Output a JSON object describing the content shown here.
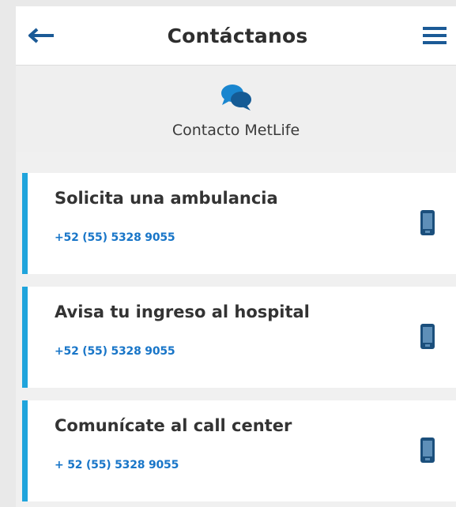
{
  "header": {
    "title": "Contáctanos",
    "back_icon": "arrow-left-icon",
    "menu_icon": "hamburger-menu-icon"
  },
  "subheader": {
    "icon": "chat-bubbles-icon",
    "label": "Contacto MetLife"
  },
  "contacts": [
    {
      "title": "Solicita una ambulancia",
      "phone": "+52 (55) 5328 9055",
      "icon": "mobile-phone-icon"
    },
    {
      "title": "Avisa tu ingreso al hospital",
      "phone": "+52 (55) 5328 9055",
      "icon": "mobile-phone-icon"
    },
    {
      "title": "Comunícate al call center",
      "phone": "+ 52 (55) 5328 9055",
      "icon": "mobile-phone-icon"
    }
  ],
  "colors": {
    "accent_blue": "#1fa4dc",
    "link_blue": "#1976c8",
    "icon_dark_blue": "#1b4f7c"
  }
}
